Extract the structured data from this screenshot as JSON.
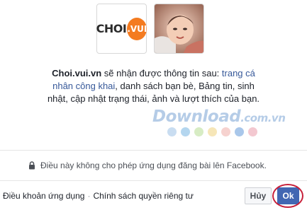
{
  "app": {
    "logo_main": "CHOI",
    "logo_badge": ".VUI",
    "name": "Choi.vui.vn"
  },
  "message": {
    "part1": " sẽ nhận được thông tin sau: ",
    "link": "trang cá nhân công khai",
    "part2": ", danh sách bạn bè, Bảng tin, sinh nhật, cập nhật trạng thái, ảnh và lượt thích của bạn."
  },
  "watermark": {
    "text": "Download",
    "suffix": ".com.vn",
    "dot_colors": [
      "#c9ddf1",
      "#b4d6ef",
      "#d7ecc4",
      "#f6e6b8",
      "#f6d2cf",
      "#a9c7ea",
      "#f3c8d0"
    ]
  },
  "notice": {
    "icon": "lock-icon",
    "text": "Điều này không cho phép ứng dụng đăng bài lên Facebook."
  },
  "footer": {
    "terms_link": "Điều khoản ứng dụng",
    "separator": "·",
    "privacy_link": "Chính sách quyền riêng tư",
    "cancel_label": "Hủy",
    "ok_label": "Ok"
  },
  "colors": {
    "brand_orange": "#f47b20",
    "link_blue": "#365899",
    "ok_blue": "#4267b2",
    "highlight_red": "#c7203a"
  }
}
